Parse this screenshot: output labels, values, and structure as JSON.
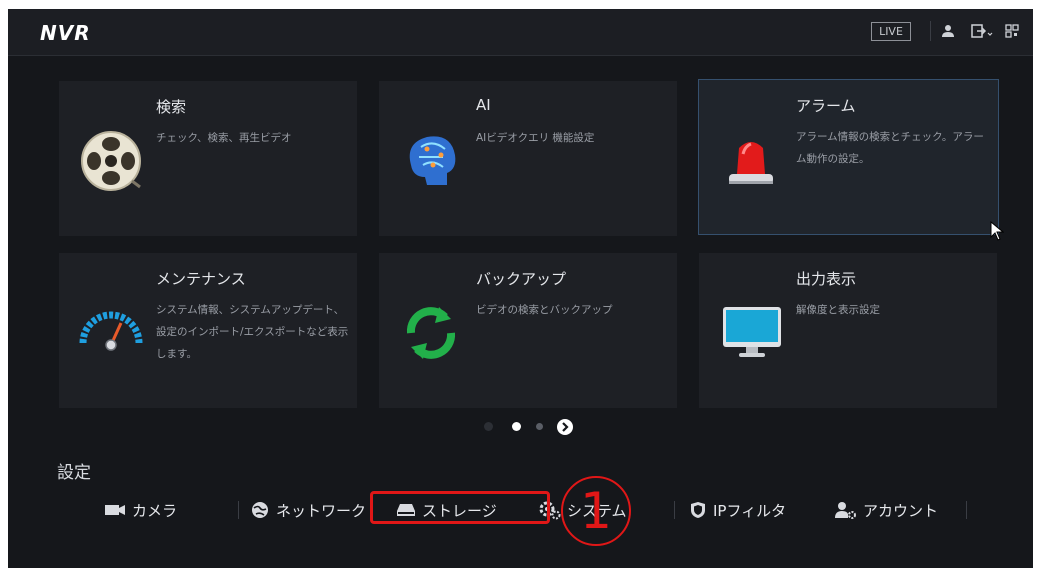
{
  "header": {
    "logo": "NVR",
    "live_label": "LIVE",
    "icons": [
      "user-icon",
      "logout-icon",
      "qr-code-icon"
    ]
  },
  "tiles": [
    {
      "title": "検索",
      "desc": "チェック、検索、再生ビデオ",
      "icon": "film-reel-icon"
    },
    {
      "title": "AI",
      "desc": "AIビデオクエリ 機能設定",
      "icon": "ai-brain-icon"
    },
    {
      "title": "アラーム",
      "desc": "アラーム情報の検索とチェック。アラーム動作の設定。",
      "icon": "alarm-siren-icon"
    },
    {
      "title": "メンテナンス",
      "desc": "システム情報、システムアップデート、設定のインポート/エクスポートなど表示します。",
      "icon": "gauge-icon"
    },
    {
      "title": "バックアップ",
      "desc": "ビデオの検索とバックアップ",
      "icon": "sync-arrows-icon"
    },
    {
      "title": "出力表示",
      "desc": "解像度と表示設定",
      "icon": "monitor-icon"
    }
  ],
  "pager": {
    "pages": 3,
    "current": 1
  },
  "settings": {
    "label": "設定",
    "items": [
      {
        "label": "カメラ",
        "icon": "camera-icon"
      },
      {
        "label": "ネットワーク",
        "icon": "network-globe-icon"
      },
      {
        "label": "ストレージ",
        "icon": "hdd-icon"
      },
      {
        "label": "システム",
        "icon": "gear-icon"
      },
      {
        "label": "IPフィルタ",
        "icon": "shield-icon"
      },
      {
        "label": "アカウント",
        "icon": "user-gear-icon"
      }
    ]
  },
  "annotation": {
    "marker": "1",
    "color": "#e01717"
  },
  "colors": {
    "background": "#15171b",
    "tile": "#1e2025",
    "selected_border": "#35506e"
  }
}
